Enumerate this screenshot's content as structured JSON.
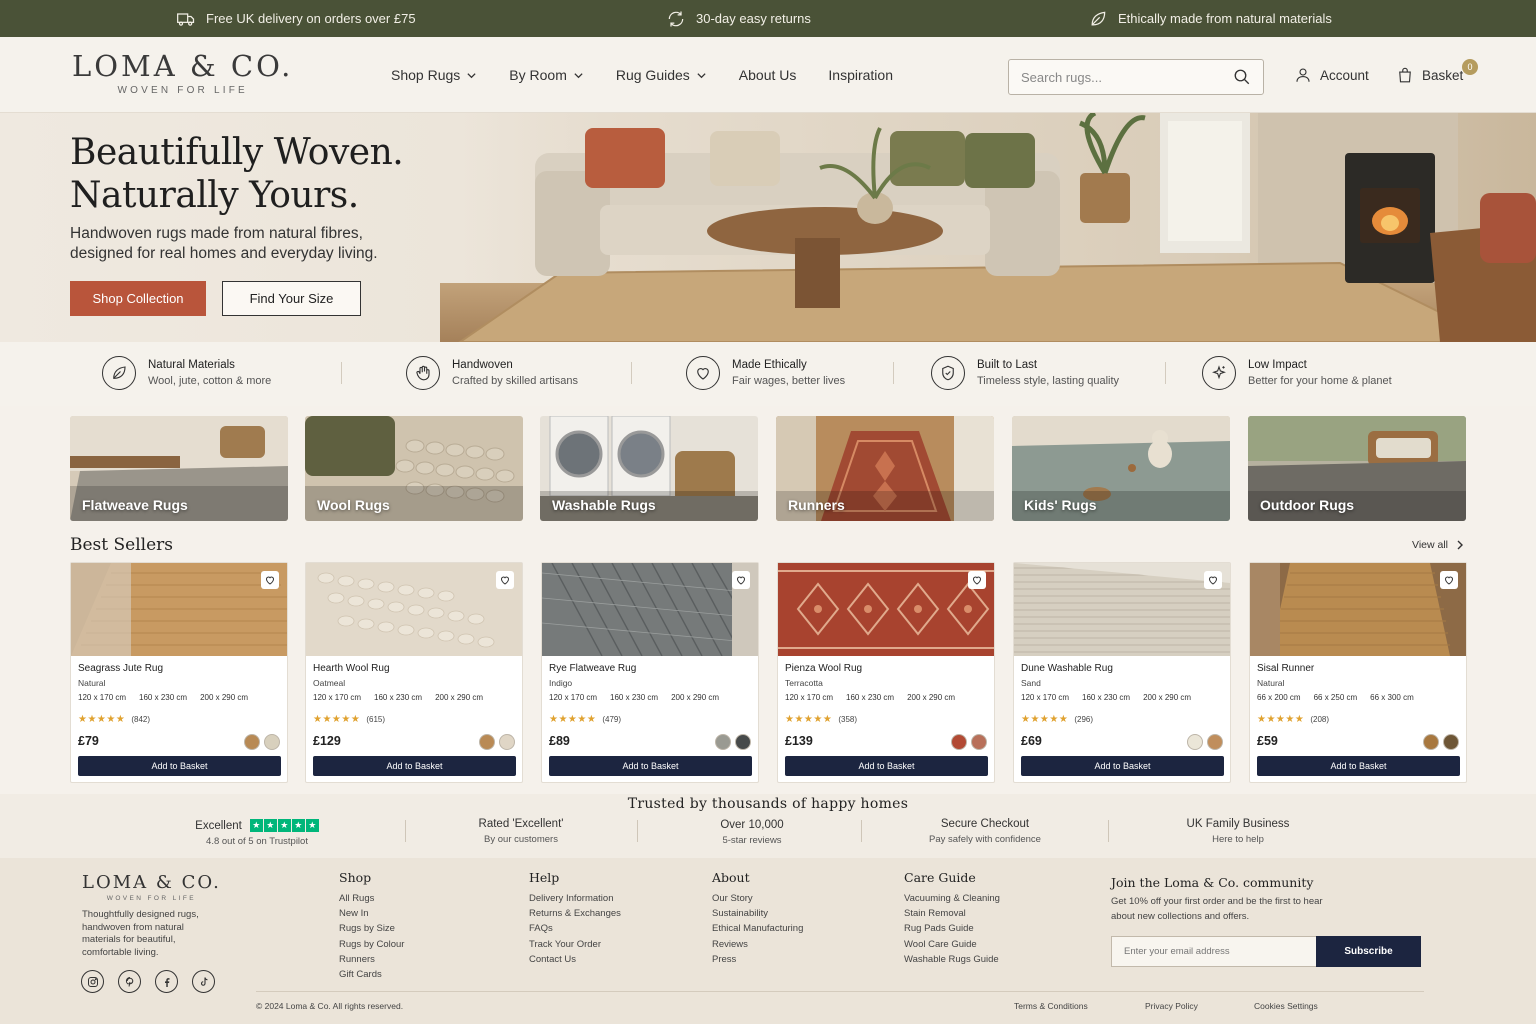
{
  "topbar": {
    "delivery": "Free UK delivery on orders over £75",
    "returns": "30-day easy returns",
    "ethical": "Ethically made from natural materials"
  },
  "header": {
    "logo": "LOMA & CO.",
    "tagline": "WOVEN FOR LIFE",
    "nav": [
      "Shop Rugs",
      "By Room",
      "Rug Guides",
      "About Us",
      "Inspiration"
    ],
    "search_placeholder": "Search rugs...",
    "account": "Account",
    "basket": "Basket",
    "basket_count": "0"
  },
  "hero": {
    "title_line1": "Beautifully Woven.",
    "title_line2": "Naturally Yours.",
    "subtitle": "Handwoven rugs made from natural fibres, designed for real homes and everyday living.",
    "primary_cta": "Shop Collection",
    "secondary_cta": "Find Your Size"
  },
  "features": [
    {
      "title": "Natural Materials",
      "sub": "Wool, jute, cotton & more",
      "icon": "leaf-icon"
    },
    {
      "title": "Handwoven",
      "sub": "Crafted by skilled artisans",
      "icon": "hand-icon"
    },
    {
      "title": "Made Ethically",
      "sub": "Fair wages, better lives",
      "icon": "heart-icon"
    },
    {
      "title": "Built to Last",
      "sub": "Timeless style, lasting quality",
      "icon": "shield-icon"
    },
    {
      "title": "Low Impact",
      "sub": "Better for your home & planet",
      "icon": "sparkle-icon"
    }
  ],
  "categories": [
    "Flatweave Rugs",
    "Wool Rugs",
    "Washable Rugs",
    "Runners",
    "Kids' Rugs",
    "Outdoor Rugs"
  ],
  "best_sellers": {
    "title": "Best Sellers",
    "view_all": "View all",
    "add_label": "Add to Basket",
    "products": [
      {
        "name": "Seagrass Jute Rug",
        "colour": "Natural",
        "sizes": [
          "120 x 170 cm",
          "160 x 230 cm",
          "200 x 290 cm"
        ],
        "reviews": "(842)",
        "price": "£79",
        "swatches": [
          "#b88a55",
          "#d8d0bd"
        ]
      },
      {
        "name": "Hearth Wool Rug",
        "colour": "Oatmeal",
        "sizes": [
          "120 x 170 cm",
          "160 x 230 cm",
          "200 x 290 cm"
        ],
        "reviews": "(615)",
        "price": "£129",
        "swatches": [
          "#b98a55",
          "#e0d6c6"
        ]
      },
      {
        "name": "Rye Flatweave Rug",
        "colour": "Indigo",
        "sizes": [
          "120 x 170 cm",
          "160 x 230 cm",
          "200 x 290 cm"
        ],
        "reviews": "(479)",
        "price": "£89",
        "swatches": [
          "#9a9a92",
          "#474a4a"
        ]
      },
      {
        "name": "Pienza Wool Rug",
        "colour": "Terracotta",
        "sizes": [
          "120 x 170 cm",
          "160 x 230 cm",
          "200 x 290 cm"
        ],
        "reviews": "(358)",
        "price": "£139",
        "swatches": [
          "#b24a34",
          "#b8705a"
        ]
      },
      {
        "name": "Dune Washable Rug",
        "colour": "Sand",
        "sizes": [
          "120 x 170 cm",
          "160 x 230 cm",
          "200 x 290 cm"
        ],
        "reviews": "(296)",
        "price": "£69",
        "swatches": [
          "#ebe6d8",
          "#c08e5c"
        ]
      },
      {
        "name": "Sisal Runner",
        "colour": "Natural",
        "sizes": [
          "66 x 200 cm",
          "66 x 250 cm",
          "66 x 300 cm"
        ],
        "reviews": "(208)",
        "price": "£59",
        "swatches": [
          "#a8783f",
          "#6e5636"
        ]
      }
    ]
  },
  "trust": {
    "title": "Trusted by thousands of happy homes",
    "trustpilot_label": "Excellent",
    "trustpilot_sub": "4.8 out of 5 on Trustpilot",
    "items": [
      {
        "title": "Rated 'Excellent'",
        "sub": "By our customers"
      },
      {
        "title": "Over 10,000",
        "sub": "5-star reviews"
      },
      {
        "title": "Secure Checkout",
        "sub": "Pay safely with confidence"
      },
      {
        "title": "UK Family Business",
        "sub": "Here to help"
      }
    ]
  },
  "footer": {
    "logo": "LOMA & CO.",
    "tagline": "WOVEN FOR LIFE",
    "description": "Thoughtfully designed rugs, handwoven from natural materials for beautiful, comfortable living.",
    "columns": [
      {
        "title": "Shop",
        "links": [
          "All Rugs",
          "New In",
          "Rugs by Size",
          "Rugs by Colour",
          "Runners",
          "Gift Cards"
        ]
      },
      {
        "title": "Help",
        "links": [
          "Delivery Information",
          "Returns & Exchanges",
          "FAQs",
          "Track Your Order",
          "Contact Us"
        ]
      },
      {
        "title": "About",
        "links": [
          "Our Story",
          "Sustainability",
          "Ethical Manufacturing",
          "Reviews",
          "Press"
        ]
      },
      {
        "title": "Care Guide",
        "links": [
          "Vacuuming & Cleaning",
          "Stain Removal",
          "Rug Pads Guide",
          "Wool Care Guide",
          "Washable Rugs Guide"
        ]
      }
    ],
    "newsletter_title": "Join the Loma & Co. community",
    "newsletter_sub": "Get 10% off your first order and be the first to hear about new collections and offers.",
    "email_placeholder": "Enter your email address",
    "subscribe": "Subscribe",
    "copyright": "© 2024 Loma & Co. All rights reserved.",
    "legal": [
      "Terms & Conditions",
      "Privacy Policy",
      "Cookies Settings"
    ]
  }
}
